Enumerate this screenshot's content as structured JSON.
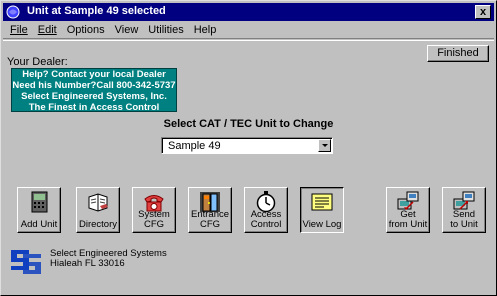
{
  "window": {
    "title": "Unit at Sample 49 selected",
    "close_label": "x"
  },
  "menu": [
    "File",
    "Edit",
    "Options",
    "View",
    "Utilities",
    "Help"
  ],
  "finished_label": "Finished",
  "dealer": {
    "label": "Your Dealer:",
    "lines": [
      "Help? Contact  your local Dealer",
      "Need his Number?Call 800-342-5737",
      "Select Engineered Systems, Inc.",
      "The Finest in Access Control"
    ]
  },
  "unit_select": {
    "label": "Select CAT / TEC Unit to Change",
    "value": "Sample 49"
  },
  "toolbar": [
    {
      "label": "Add  Unit",
      "icon": "add-unit-icon"
    },
    {
      "label": "Directory",
      "icon": "directory-icon"
    },
    {
      "label_top": "System",
      "label": "CFG",
      "icon": "phone-icon"
    },
    {
      "label_top": "Entrance",
      "label": "CFG",
      "icon": "door-icon"
    },
    {
      "label_top": "Access",
      "label": "Control",
      "icon": "stopwatch-icon"
    },
    {
      "label": "View Log",
      "icon": "log-icon"
    },
    {
      "label_top": "Get",
      "label": "from Unit",
      "icon": "get-from-unit-icon"
    },
    {
      "label_top": "Send",
      "label": "to Unit",
      "icon": "send-to-unit-icon"
    }
  ],
  "company": {
    "name": "Select Engineered Systems",
    "address": "Hialeah FL 33016"
  },
  "colors": {
    "titlebar": "#000080",
    "dealer_box": "#008080",
    "face": "#c0c0c0",
    "logo": "#1040c0"
  }
}
